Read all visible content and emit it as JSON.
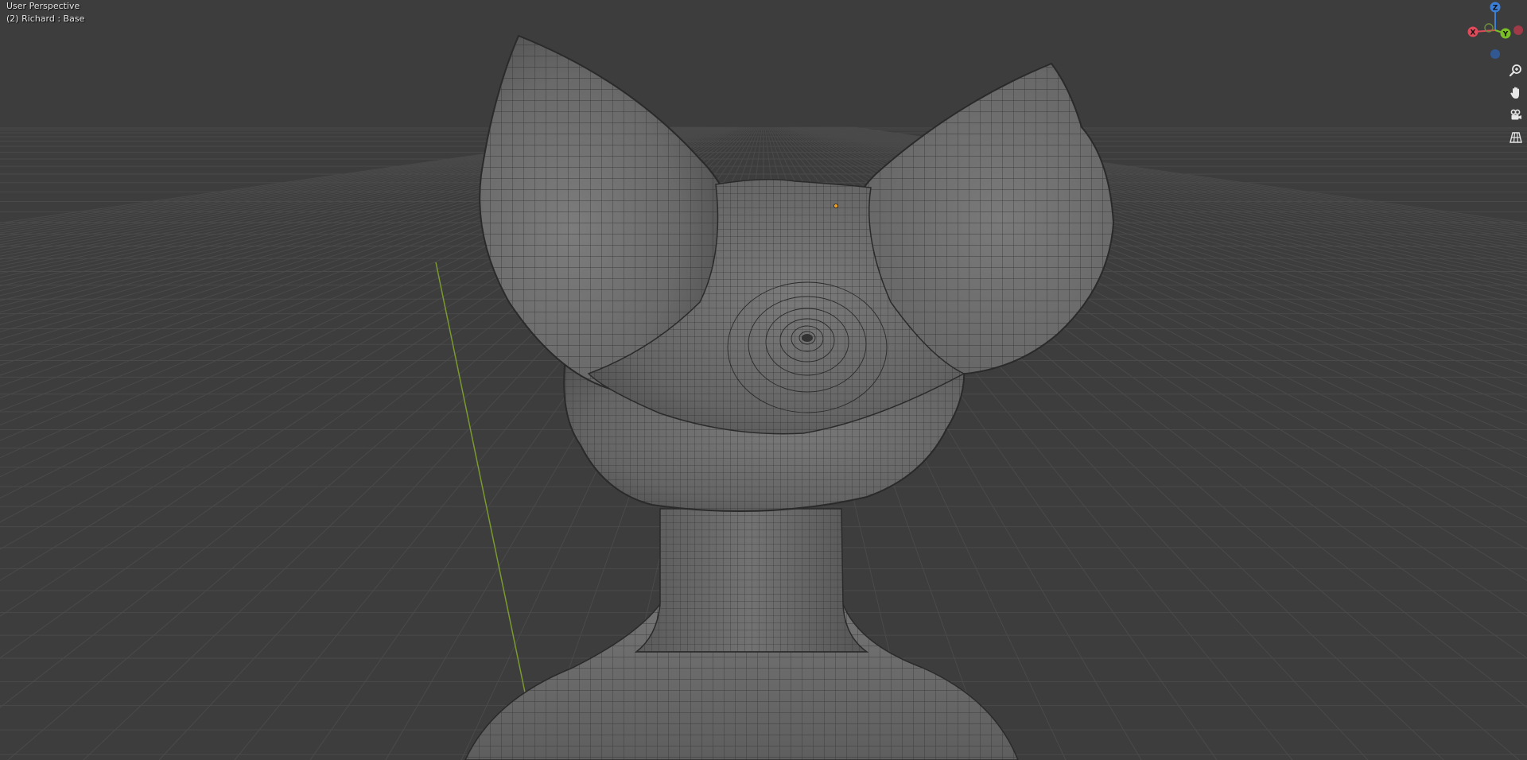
{
  "viewport": {
    "view_name": "User Perspective",
    "object_info": "(2) Richard : Base"
  },
  "gizmo": {
    "axis_z": "Z",
    "axis_y": "Y",
    "axis_x": "X",
    "colors": {
      "x": "#e04a5a",
      "y": "#7bbf27",
      "z": "#3b7fd9",
      "x_neg": "#b03a48",
      "y_neg": "#6d8e3b",
      "z_neg": "#2f5da0"
    }
  },
  "nav_buttons": [
    {
      "name": "zoom",
      "icon": "zoom-icon"
    },
    {
      "name": "pan",
      "icon": "hand-icon"
    },
    {
      "name": "camera",
      "icon": "camera-icon"
    },
    {
      "name": "orthographic",
      "icon": "grid-icon"
    }
  ],
  "colors": {
    "background": "#3d3d3d",
    "grid_line": "#4a4a4a",
    "y_axis_line": "#7a9a2e",
    "mesh_fill": "#6f6f6f",
    "mesh_wire": "#2a2a2a",
    "origin_dot": "#f0a020"
  }
}
